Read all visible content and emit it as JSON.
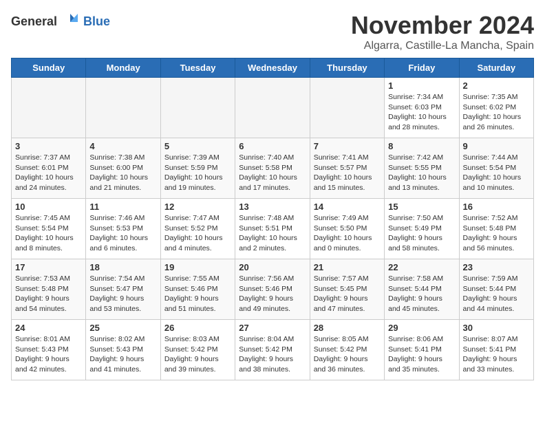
{
  "logo": {
    "text_general": "General",
    "text_blue": "Blue"
  },
  "title": {
    "month": "November 2024",
    "location": "Algarra, Castille-La Mancha, Spain"
  },
  "weekdays": [
    "Sunday",
    "Monday",
    "Tuesday",
    "Wednesday",
    "Thursday",
    "Friday",
    "Saturday"
  ],
  "weeks": [
    [
      {
        "day": "",
        "info": ""
      },
      {
        "day": "",
        "info": ""
      },
      {
        "day": "",
        "info": ""
      },
      {
        "day": "",
        "info": ""
      },
      {
        "day": "",
        "info": ""
      },
      {
        "day": "1",
        "info": "Sunrise: 7:34 AM\nSunset: 6:03 PM\nDaylight: 10 hours\nand 28 minutes."
      },
      {
        "day": "2",
        "info": "Sunrise: 7:35 AM\nSunset: 6:02 PM\nDaylight: 10 hours\nand 26 minutes."
      }
    ],
    [
      {
        "day": "3",
        "info": "Sunrise: 7:37 AM\nSunset: 6:01 PM\nDaylight: 10 hours\nand 24 minutes."
      },
      {
        "day": "4",
        "info": "Sunrise: 7:38 AM\nSunset: 6:00 PM\nDaylight: 10 hours\nand 21 minutes."
      },
      {
        "day": "5",
        "info": "Sunrise: 7:39 AM\nSunset: 5:59 PM\nDaylight: 10 hours\nand 19 minutes."
      },
      {
        "day": "6",
        "info": "Sunrise: 7:40 AM\nSunset: 5:58 PM\nDaylight: 10 hours\nand 17 minutes."
      },
      {
        "day": "7",
        "info": "Sunrise: 7:41 AM\nSunset: 5:57 PM\nDaylight: 10 hours\nand 15 minutes."
      },
      {
        "day": "8",
        "info": "Sunrise: 7:42 AM\nSunset: 5:55 PM\nDaylight: 10 hours\nand 13 minutes."
      },
      {
        "day": "9",
        "info": "Sunrise: 7:44 AM\nSunset: 5:54 PM\nDaylight: 10 hours\nand 10 minutes."
      }
    ],
    [
      {
        "day": "10",
        "info": "Sunrise: 7:45 AM\nSunset: 5:54 PM\nDaylight: 10 hours\nand 8 minutes."
      },
      {
        "day": "11",
        "info": "Sunrise: 7:46 AM\nSunset: 5:53 PM\nDaylight: 10 hours\nand 6 minutes."
      },
      {
        "day": "12",
        "info": "Sunrise: 7:47 AM\nSunset: 5:52 PM\nDaylight: 10 hours\nand 4 minutes."
      },
      {
        "day": "13",
        "info": "Sunrise: 7:48 AM\nSunset: 5:51 PM\nDaylight: 10 hours\nand 2 minutes."
      },
      {
        "day": "14",
        "info": "Sunrise: 7:49 AM\nSunset: 5:50 PM\nDaylight: 10 hours\nand 0 minutes."
      },
      {
        "day": "15",
        "info": "Sunrise: 7:50 AM\nSunset: 5:49 PM\nDaylight: 9 hours\nand 58 minutes."
      },
      {
        "day": "16",
        "info": "Sunrise: 7:52 AM\nSunset: 5:48 PM\nDaylight: 9 hours\nand 56 minutes."
      }
    ],
    [
      {
        "day": "17",
        "info": "Sunrise: 7:53 AM\nSunset: 5:48 PM\nDaylight: 9 hours\nand 54 minutes."
      },
      {
        "day": "18",
        "info": "Sunrise: 7:54 AM\nSunset: 5:47 PM\nDaylight: 9 hours\nand 53 minutes."
      },
      {
        "day": "19",
        "info": "Sunrise: 7:55 AM\nSunset: 5:46 PM\nDaylight: 9 hours\nand 51 minutes."
      },
      {
        "day": "20",
        "info": "Sunrise: 7:56 AM\nSunset: 5:46 PM\nDaylight: 9 hours\nand 49 minutes."
      },
      {
        "day": "21",
        "info": "Sunrise: 7:57 AM\nSunset: 5:45 PM\nDaylight: 9 hours\nand 47 minutes."
      },
      {
        "day": "22",
        "info": "Sunrise: 7:58 AM\nSunset: 5:44 PM\nDaylight: 9 hours\nand 45 minutes."
      },
      {
        "day": "23",
        "info": "Sunrise: 7:59 AM\nSunset: 5:44 PM\nDaylight: 9 hours\nand 44 minutes."
      }
    ],
    [
      {
        "day": "24",
        "info": "Sunrise: 8:01 AM\nSunset: 5:43 PM\nDaylight: 9 hours\nand 42 minutes."
      },
      {
        "day": "25",
        "info": "Sunrise: 8:02 AM\nSunset: 5:43 PM\nDaylight: 9 hours\nand 41 minutes."
      },
      {
        "day": "26",
        "info": "Sunrise: 8:03 AM\nSunset: 5:42 PM\nDaylight: 9 hours\nand 39 minutes."
      },
      {
        "day": "27",
        "info": "Sunrise: 8:04 AM\nSunset: 5:42 PM\nDaylight: 9 hours\nand 38 minutes."
      },
      {
        "day": "28",
        "info": "Sunrise: 8:05 AM\nSunset: 5:42 PM\nDaylight: 9 hours\nand 36 minutes."
      },
      {
        "day": "29",
        "info": "Sunrise: 8:06 AM\nSunset: 5:41 PM\nDaylight: 9 hours\nand 35 minutes."
      },
      {
        "day": "30",
        "info": "Sunrise: 8:07 AM\nSunset: 5:41 PM\nDaylight: 9 hours\nand 33 minutes."
      }
    ]
  ]
}
